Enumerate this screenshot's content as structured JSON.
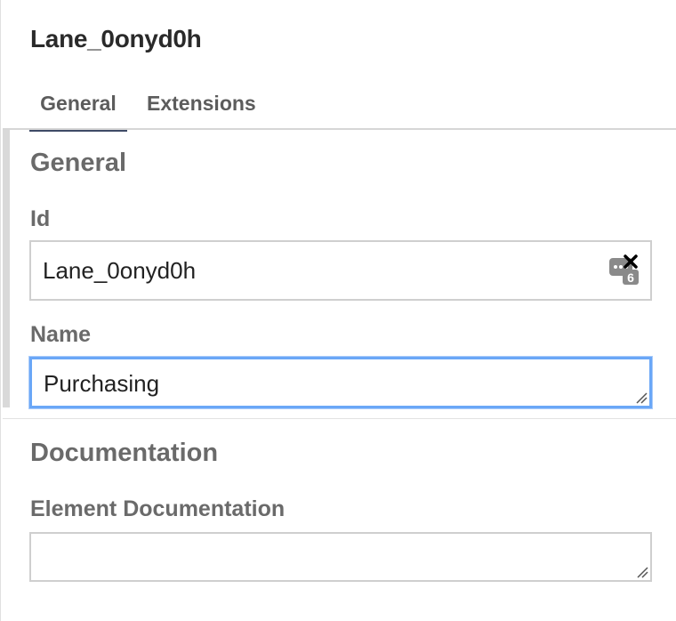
{
  "header": {
    "title": "Lane_0onyd0h"
  },
  "tabs": [
    {
      "label": "General",
      "active": true
    },
    {
      "label": "Extensions",
      "active": false
    }
  ],
  "general_group": {
    "heading": "General",
    "id_label": "Id",
    "id_value": "Lane_0onyd0h",
    "id_icon": "password-manager-icon",
    "id_icon_badge": "6",
    "name_label": "Name",
    "name_value": "Purchasing"
  },
  "documentation_group": {
    "heading": "Documentation",
    "element_doc_label": "Element Documentation",
    "element_doc_value": ""
  },
  "colors": {
    "tab_active_underline": "#3e4a66",
    "focus_border": "#6aa7f7",
    "label_gray": "#6a6a6a"
  }
}
